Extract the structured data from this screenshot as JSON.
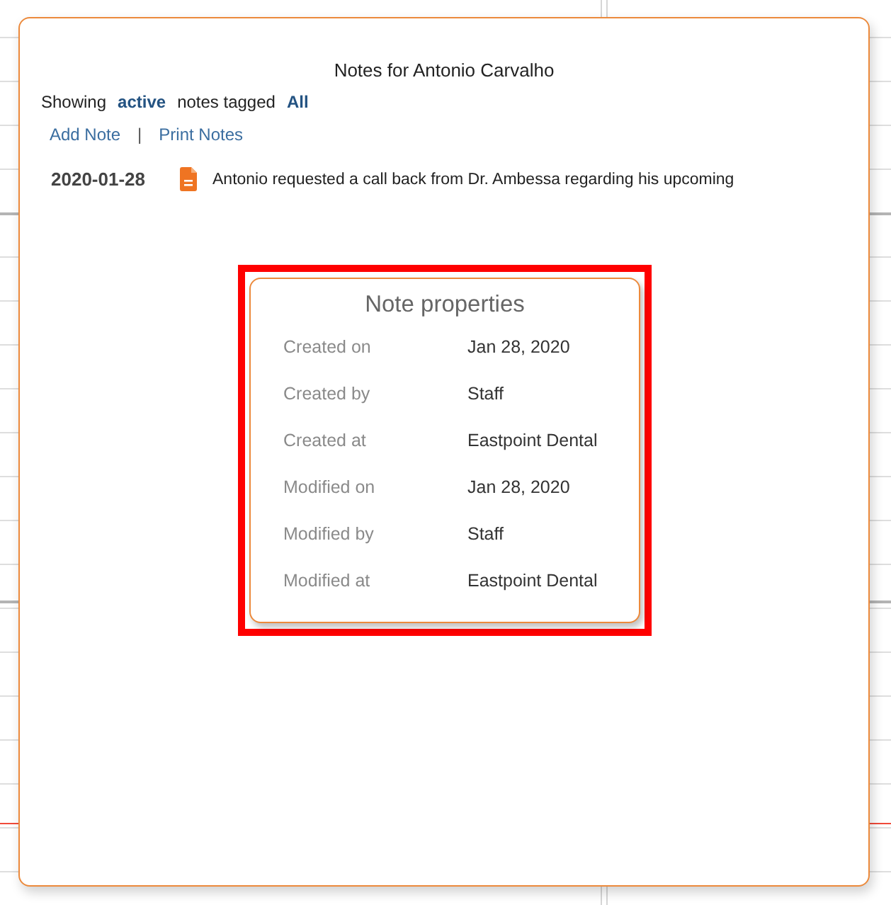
{
  "dialog": {
    "title": "Notes for Antonio Carvalho"
  },
  "filter": {
    "prefix": "Showing",
    "status": "active",
    "middle": "notes tagged",
    "tag": "All"
  },
  "actions": {
    "links": [
      "Add Note",
      "Print Notes"
    ],
    "separator": "|"
  },
  "notes": [
    {
      "date": "2020-01-28",
      "kind": "document",
      "text": "Antonio requested a call back from Dr. Ambessa regarding his upcoming"
    }
  ],
  "properties_popover": {
    "title": "Note properties",
    "highlighted": true,
    "rows": [
      {
        "label": "Created on",
        "value": "Jan 28, 2020"
      },
      {
        "label": "Created by",
        "value": "Staff"
      },
      {
        "label": "Created at",
        "value": "Eastpoint Dental"
      },
      {
        "label": "Modified on",
        "value": "Jan 28, 2020"
      },
      {
        "label": "Modified by",
        "value": "Staff"
      },
      {
        "label": "Modified at",
        "value": "Eastpoint Dental"
      }
    ]
  }
}
